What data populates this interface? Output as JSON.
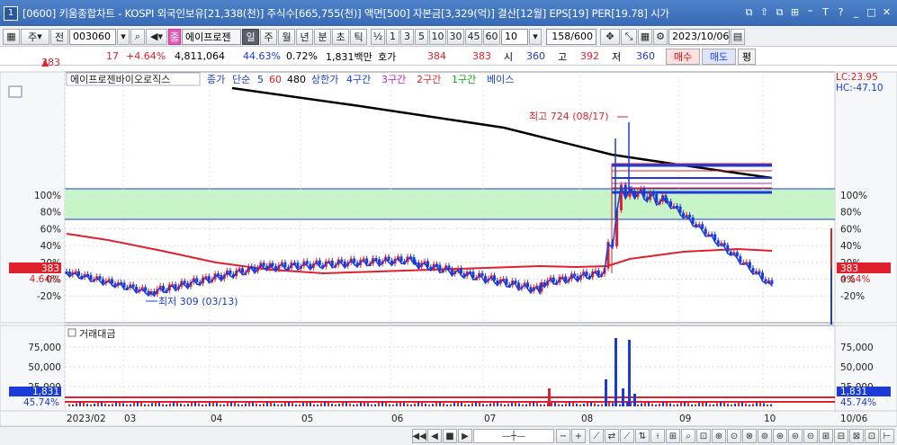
{
  "window": {
    "number": "1",
    "title": "[0600] 키움종합차트 - KOSPI 외국인보유[21,338(천)] 주식수[665,755(천)] 액면[500] 자본금[3,329(억)] 결산[12월] EPS[19] PER[19.78] 시가",
    "controls": [
      "⧉",
      "⇧",
      "⧉",
      "⊞",
      "⁼",
      "T",
      "?",
      "_",
      "□",
      "✕"
    ]
  },
  "toolbar1": {
    "period": "주",
    "prev_label": "전",
    "code": "003060",
    "stock_badge": "종",
    "stock_name": "에이프로젠",
    "intervals": [
      "일",
      "주",
      "월",
      "년",
      "분",
      "초",
      "틱"
    ],
    "selected_interval": "일",
    "fraction_label": "½",
    "minutes": [
      "1",
      "3",
      "5",
      "10",
      "30",
      "45",
      "60"
    ],
    "count_value": "10",
    "range_value": "158",
    "range_total": "/600",
    "date": "2023/10/06"
  },
  "toolbar2": {
    "price": "383",
    "change_arrow": "▲",
    "change": "17",
    "change_pct": "+4.64%",
    "volume": "4,811,064",
    "vol_ratio": "44.63%",
    "turnover": "0.72%",
    "amount": "1,831백만",
    "bid_label": "호가",
    "ask": "384",
    "bid": "383",
    "open_label": "시",
    "open": "360",
    "high_label": "고",
    "high": "392",
    "low_label": "저",
    "low": "360",
    "buy": "매수",
    "sell": "매도",
    "eval": "평"
  },
  "legend": {
    "name": "에이프로젠바이오로직스",
    "items": [
      {
        "text": "종가",
        "color": "#1a3bd6"
      },
      {
        "text": "단순",
        "color": "#1a3bd6"
      },
      {
        "text": "5",
        "color": "#1a3bd6"
      },
      {
        "text": "60",
        "color": "#e0202a"
      },
      {
        "text": "480",
        "color": "#000000"
      },
      {
        "text": "상한가",
        "color": "#1a3bd6"
      },
      {
        "text": "4구간",
        "color": "#1a3bd6"
      },
      {
        "text": "3구간",
        "color": "#c020c0"
      },
      {
        "text": "2구간",
        "color": "#e0202a"
      },
      {
        "text": "1구간",
        "color": "#10a010"
      },
      {
        "text": "베이스",
        "color": "#1a3bd6"
      }
    ],
    "lc": "LC:23.95",
    "hc": "HC:-47.10"
  },
  "price_chart": {
    "y_ticks_left": [
      "100%",
      "80%",
      "60%",
      "40%",
      "20%",
      "0%",
      "-20%"
    ],
    "y_ticks_right": [
      "100%",
      "80%",
      "60%",
      "40%",
      "20%",
      "0%",
      "-20%"
    ],
    "current_price": "383",
    "current_pct": "4.64%",
    "high_annotation": "최고 724 (08/17)",
    "low_annotation": "최저 309 (03/13)"
  },
  "volume_chart": {
    "title": "거래대금",
    "y_ticks": [
      "75,000",
      "50,000",
      "25,000"
    ],
    "current_value": "1,831",
    "current_pct": "45.74%"
  },
  "x_axis": {
    "labels": [
      "2023/02",
      "03",
      "04",
      "05",
      "06",
      "07",
      "08",
      "09",
      "10"
    ],
    "right_label": "10/06"
  },
  "colors": {
    "up": "#e0202a",
    "down": "#1a3bd6",
    "ma480": "#000000",
    "band": "#c8f5c8",
    "title_bg": "#3869b5"
  }
}
